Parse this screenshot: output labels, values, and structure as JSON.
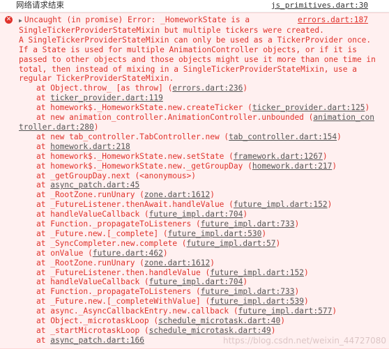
{
  "top": {
    "message": "网络请求结束",
    "source": "js_primitives.dart:30"
  },
  "error": {
    "icon": "error-icon",
    "first_line": "Uncaught (in promise) Error: _HomeworkState is a",
    "source": "errors.dart:187",
    "lines": [
      "SingleTickerProviderStateMixin but multiple tickers were created.",
      "A SingleTickerProviderStateMixin can only be used as a TickerProvider once.",
      "If a State is used for multiple AnimationController objects, or if it is",
      "passed to other objects and those objects might use it more than one time in",
      "total, then instead of mixing in a SingleTickerProviderStateMixin, use a",
      "regular TickerProviderStateMixin."
    ],
    "frames": [
      {
        "text": "at Object.throw_ [as throw] (",
        "link": "errors.dart:236",
        "suffix": ")"
      },
      {
        "text": "at ",
        "link": "ticker_provider.dart:119",
        "suffix": ""
      },
      {
        "text": "at homework$._HomeworkState.new.createTicker (",
        "link": "ticker_provider.dart:125",
        "suffix": ")"
      },
      {
        "text": "at new animation_controller.AnimationController.unbounded (",
        "link": "animation_con",
        "link2": "troller.dart:280",
        "suffix": ")",
        "wrapped": true
      },
      {
        "text": "at new tab_controller.TabController.new (",
        "link": "tab_controller.dart:154",
        "suffix": ")"
      },
      {
        "text": "at ",
        "link": "homework.dart:218",
        "suffix": ""
      },
      {
        "text": "at homework$._HomeworkState.new.setState (",
        "link": "framework.dart:1267",
        "suffix": ")"
      },
      {
        "text": "at homework$._HomeworkState.new._getGroupDay (",
        "link": "homework.dart:217",
        "suffix": ")"
      },
      {
        "text": "at _getGroupDay.next (<anonymous>)",
        "link": "",
        "suffix": ""
      },
      {
        "text": "at ",
        "link": "async_patch.dart:45",
        "suffix": ""
      },
      {
        "text": "at _RootZone.runUnary (",
        "link": "zone.dart:1612",
        "suffix": ")"
      },
      {
        "text": "at _FutureListener.thenAwait.handleValue (",
        "link": "future_impl.dart:152",
        "suffix": ")"
      },
      {
        "text": "at handleValueCallback (",
        "link": "future_impl.dart:704",
        "suffix": ")"
      },
      {
        "text": "at Function._propagateToListeners (",
        "link": "future_impl.dart:733",
        "suffix": ")"
      },
      {
        "text": "at _Future.new.[_complete] (",
        "link": "future_impl.dart:530",
        "suffix": ")"
      },
      {
        "text": "at _SyncCompleter.new.complete (",
        "link": "future_impl.dart:57",
        "suffix": ")"
      },
      {
        "text": "at onValue (",
        "link": "future.dart:462",
        "suffix": ")"
      },
      {
        "text": "at _RootZone.runUnary (",
        "link": "zone.dart:1612",
        "suffix": ")"
      },
      {
        "text": "at _FutureListener.then.handleValue (",
        "link": "future_impl.dart:152",
        "suffix": ")"
      },
      {
        "text": "at handleValueCallback (",
        "link": "future_impl.dart:704",
        "suffix": ")"
      },
      {
        "text": "at Function._propagateToListeners (",
        "link": "future_impl.dart:733",
        "suffix": ")"
      },
      {
        "text": "at _Future.new.[_completeWithValue] (",
        "link": "future_impl.dart:539",
        "suffix": ")"
      },
      {
        "text": "at async._AsyncCallbackEntry.new.callback (",
        "link": "future_impl.dart:577",
        "suffix": ")"
      },
      {
        "text": "at Object._microtaskLoop (",
        "link": "schedule_microtask.dart:40",
        "suffix": ")"
      },
      {
        "text": "at _startMicrotaskLoop (",
        "link": "schedule_microtask.dart:49",
        "suffix": ")"
      },
      {
        "text": "at ",
        "link": "async_patch.dart:166",
        "suffix": ""
      }
    ]
  },
  "watermark": "https://blog.csdn.net/weixin_44727080",
  "colors": {
    "error_red": "#e0332c",
    "error_bg": "#fff0f0",
    "link_gray": "#555555"
  }
}
